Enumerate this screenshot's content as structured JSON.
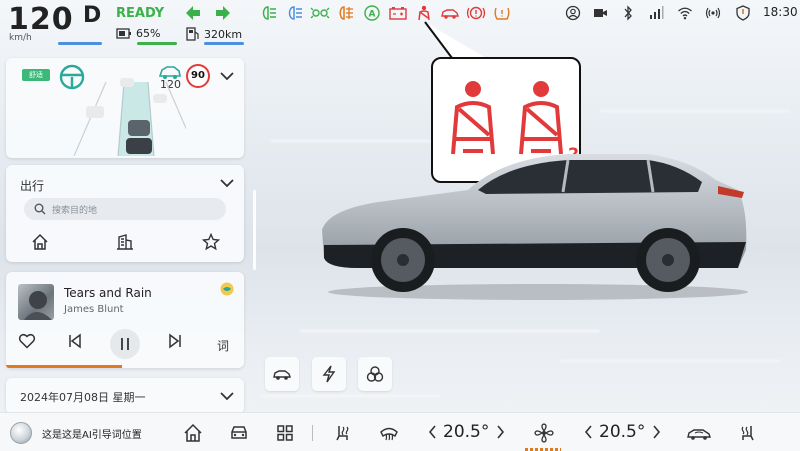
{
  "status": {
    "speed": "120",
    "speed_unit": "km/h",
    "gear": "D",
    "ready": "READY",
    "battery": "65%",
    "range": "320km",
    "time": "18:30"
  },
  "callout": {
    "seatbelt_second_index": "2"
  },
  "adas": {
    "mode_tag": "舒适",
    "follow_speed": "120",
    "speed_limit": "90"
  },
  "nav": {
    "title": "出行",
    "search_placeholder": "搜索目的地"
  },
  "music": {
    "song": "Tears and Rain",
    "artist": "James Blunt",
    "lyric_label": "词"
  },
  "date_card": {
    "date": "2024年07月08日  星期一"
  },
  "dock": {
    "ai_text": "这是这是AI引导词位置",
    "temp_left": "20.5°",
    "temp_right": "20.5°"
  },
  "colors": {
    "ready_green": "#3cb04a",
    "warning_red": "#e23a3a",
    "teal": "#2aa89a",
    "accent_blue": "#4a8fe0",
    "progress_orange": "#e07a1f"
  }
}
